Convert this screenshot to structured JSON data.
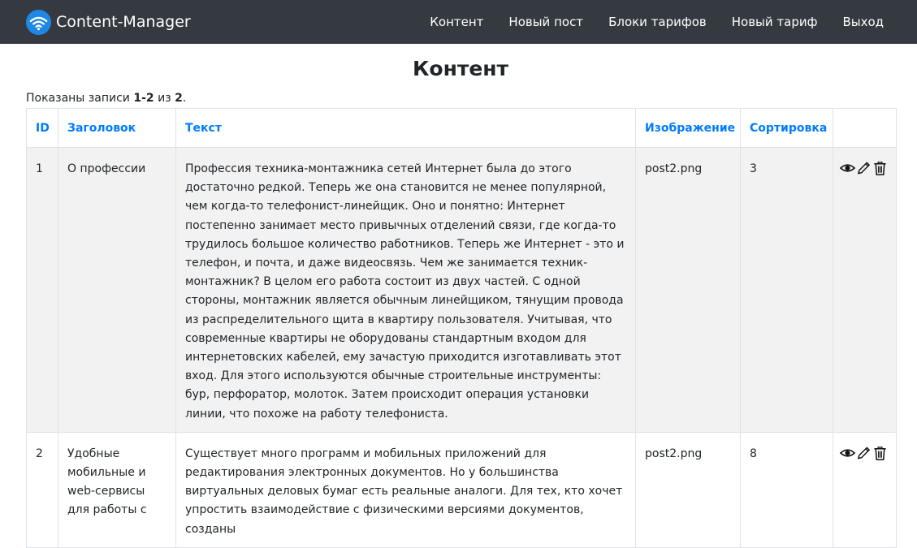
{
  "navbar": {
    "brand": "Content-Manager",
    "logo_icon": "wifi-icon",
    "links": [
      "Контент",
      "Новый пост",
      "Блоки тарифов",
      "Новый тариф",
      "Выход"
    ]
  },
  "page": {
    "title": "Контент",
    "summary": {
      "prefix": "Показаны записи ",
      "range": "1-2",
      "middle": " из ",
      "total": "2",
      "suffix": "."
    }
  },
  "table": {
    "columns": [
      "ID",
      "Заголовок",
      "Текст",
      "Изображение",
      "Сортировка"
    ],
    "action_icons": [
      "eye-icon",
      "pencil-icon",
      "trash-icon"
    ],
    "rows": [
      {
        "id": "1",
        "title": "О профессии",
        "text": "Профессия техника-монтажника сетей Интернет была до этого достаточно редкой. Теперь же она становится не менее популярной, чем когда-то телефонист-линейщик. Оно и понятно: Интернет постепенно занимает место привычных отделений связи, где когда-то трудилось большое количество работников. Теперь же Интернет - это и телефон, и почта, и даже видеосвязь. Чем же занимается техник-монтажник? В целом его работа состоит из двух частей. С одной стороны, монтажник является обычным линейщиком, тянущим провода из распределительного щита в квартиру пользователя. Учитывая, что современные квартиры не оборудованы стандартным входом для интернетовских кабелей, ему зачастую приходится изготавливать этот вход. Для этого используются обычные строительные инструменты: бур, перфоратор, молоток. Затем происходит операция установки линии, что похоже на работу телефониста.",
        "image": "post2.png",
        "sort": "3"
      },
      {
        "id": "2",
        "title": "Удобные мобильные и web-сервисы для работы с",
        "text": "Существует много программ и мобильных приложений для редактирования электронных документов. Но у большинства виртуальных деловых бумаг есть реальные аналоги. Для тех, кто хочет упростить взаимодействие с физическими версиями документов, созданы",
        "image": "post2.png",
        "sort": "8"
      }
    ]
  }
}
